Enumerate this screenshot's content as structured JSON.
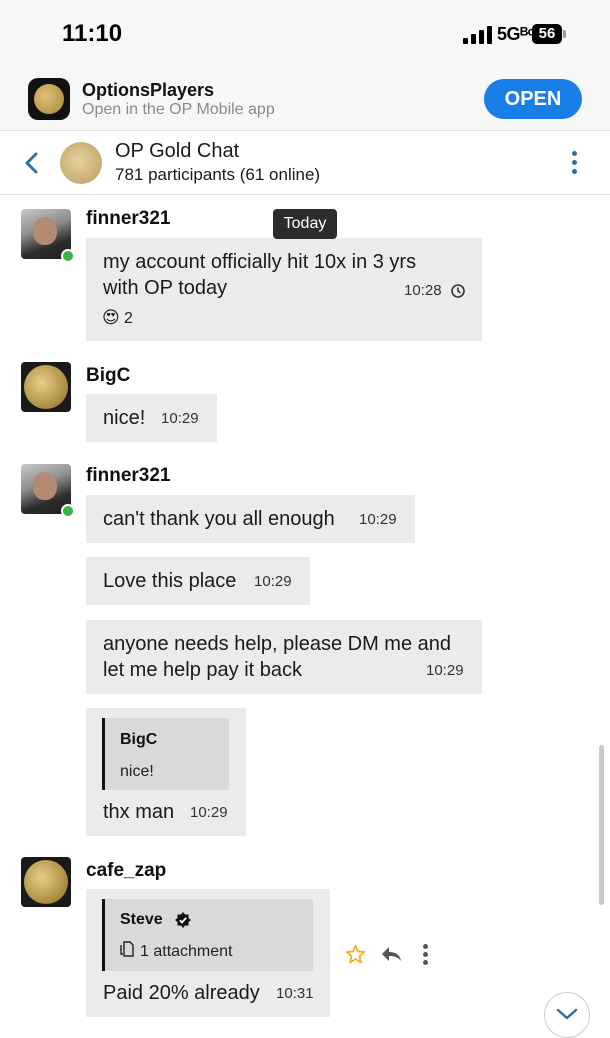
{
  "status_bar": {
    "time": "11:10",
    "network": "5Gᴮᶜ",
    "battery": "56"
  },
  "app_banner": {
    "name": "OptionsPlayers",
    "subtitle": "Open in the OP Mobile app",
    "open_label": "OPEN"
  },
  "chat_header": {
    "title": "OP Gold Chat",
    "participants": "781 participants (61 online)"
  },
  "date_divider": "Today",
  "messages": [
    {
      "author": "finner321",
      "lines": [
        "my account officially hit 10x in 3 yrs",
        "with OP today"
      ],
      "time": "10:28",
      "reaction": {
        "emoji": "😍",
        "count": "2"
      }
    },
    {
      "author": "BigC",
      "text": "nice!",
      "time": "10:29"
    },
    {
      "author": "finner321",
      "text": "can't thank you all enough",
      "time": "10:29"
    },
    {
      "text": "Love this place",
      "time": "10:29"
    },
    {
      "lines": [
        "anyone needs help, please DM me and",
        "let me help pay it back"
      ],
      "time": "10:29"
    },
    {
      "quote": {
        "name": "BigC",
        "text": "nice!"
      },
      "text": "thx man",
      "time": "10:29"
    },
    {
      "author": "cafe_zap",
      "quote": {
        "name": "Steve",
        "attachment": "1 attachment"
      },
      "text": "Paid 20% already",
      "time": "10:31"
    }
  ],
  "icons": [
    "back-chevron-icon",
    "more-vertical-icon",
    "pending-clock-icon",
    "verified-badge-icon",
    "attachment-icon",
    "star-icon",
    "reply-icon",
    "chevron-down-icon"
  ],
  "colors": {
    "accent": "#1a7ee8",
    "bubble": "#ebebeb",
    "quote": "#d9d9d9",
    "online": "#3bb34a",
    "star": "#f2b019"
  }
}
